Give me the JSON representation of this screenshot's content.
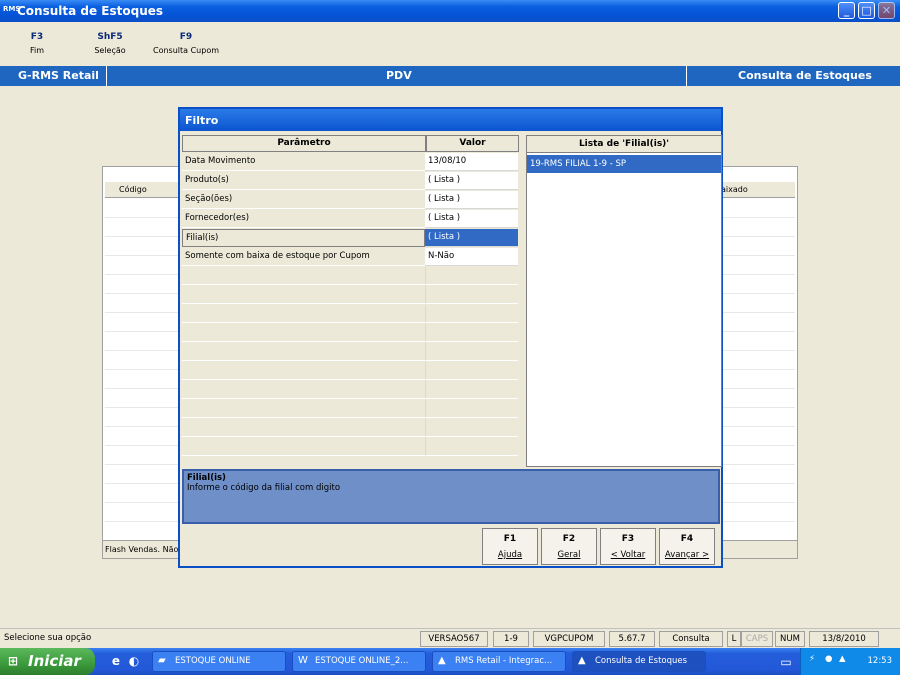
{
  "window": {
    "title": "Consulta de Estoques",
    "logo_text": "RMS"
  },
  "function_keys": [
    {
      "key": "F3",
      "label": "Fim"
    },
    {
      "key": "ShF5",
      "label": "Seleção"
    },
    {
      "key": "F9",
      "label": "Consulta Cupom"
    }
  ],
  "band": {
    "left": "G-RMS Retail",
    "center": "PDV",
    "right": "Consulta de Estoques"
  },
  "background_panel": {
    "col_codigo": "Código",
    "col_right": "aixado",
    "footer": "Flash Vendas. Não"
  },
  "dialog": {
    "title": "Filtro",
    "col_param": "Parâmetro",
    "col_valor": "Valor",
    "list_title": "Lista de 'Filial(is)'",
    "list_items": [
      "19-RMS FILIAL 1-9 - SP"
    ],
    "rows": [
      {
        "param": "Data Movimento",
        "value": "13/08/10"
      },
      {
        "param": "Produto(s)",
        "value": "( Lista )"
      },
      {
        "param": "Seção(ões)",
        "value": "( Lista )"
      },
      {
        "param": "Fornecedor(es)",
        "value": "( Lista )"
      },
      {
        "param": "Filial(is)",
        "value": "( Lista )"
      },
      {
        "param": "Somente com baixa de estoque por Cupom",
        "value": "N-Não"
      }
    ],
    "help_title": "Filial(is)",
    "help_text": "Informe o código da filial com digito",
    "buttons": [
      {
        "key": "F1",
        "label": "Ajuda"
      },
      {
        "key": "F2",
        "label": "Geral"
      },
      {
        "key": "F3",
        "label": "< Voltar"
      },
      {
        "key": "F4",
        "label": "Avançar >"
      }
    ]
  },
  "status": {
    "message": "Selecione sua opção",
    "version": "VERSAO567",
    "range": "1-9",
    "server": "VGPCUPOM",
    "build": "5.67.7",
    "mode": "Consulta",
    "l": "L",
    "caps": "CAPS",
    "num": "NUM",
    "date": "13/8/2010"
  },
  "taskbar": {
    "start": "Iniciar",
    "tasks": [
      {
        "label": "ESTOQUE ONLINE",
        "icon": "folder-icon"
      },
      {
        "label": "ESTOQUE ONLINE_2...",
        "icon": "word-icon"
      },
      {
        "label": "RMS Retail - Integrac...",
        "icon": "rms-icon"
      },
      {
        "label": "Consulta de Estoques",
        "icon": "rms-icon"
      }
    ],
    "clock": "12:53"
  }
}
